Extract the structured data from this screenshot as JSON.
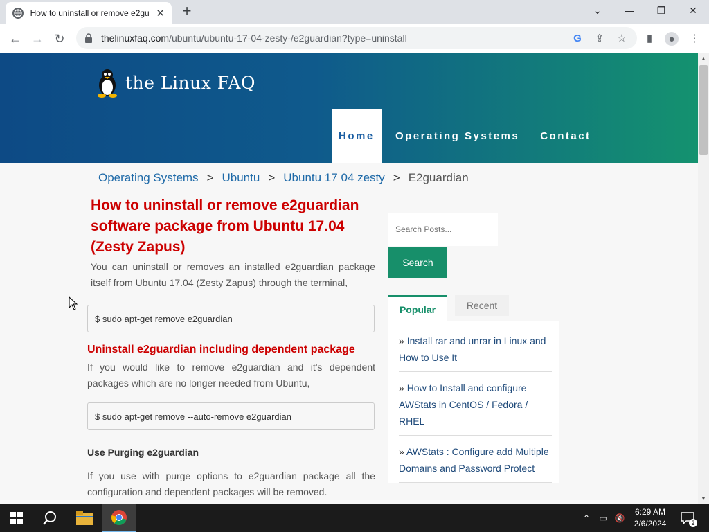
{
  "browser": {
    "tab_title": "How to uninstall or remove e2gu",
    "url_host": "thelinuxfaq.com",
    "url_path": "/ubuntu/ubuntu-17-04-zesty-/e2guardian?type=uninstall"
  },
  "site": {
    "logo_text": "the Linux FAQ",
    "nav": [
      "Home",
      "Operating Systems",
      "Contact"
    ]
  },
  "breadcrumb": {
    "items": [
      "Operating Systems",
      "Ubuntu",
      "Ubuntu 17 04 zesty"
    ],
    "separator": ">",
    "current": "E2guardian"
  },
  "article": {
    "title": "How to uninstall or remove e2guardian software package from Ubuntu 17.04 (Zesty Zapus)",
    "intro": "You can uninstall or removes an installed e2guardian package itself from Ubuntu 17.04 (Zesty Zapus) through the terminal,",
    "cmd1": "$ sudo apt-get remove e2guardian",
    "section2_title": "Uninstall e2guardian including dependent package",
    "section2_text": "If you would like to remove e2guardian and it's dependent packages which are no longer needed from Ubuntu,",
    "cmd2": "$ sudo apt-get remove --auto-remove e2guardian",
    "section3_title": "Use Purging e2guardian",
    "section3_text": "If you use with purge options to e2guardian package all the configuration and dependent packages will be removed."
  },
  "sidebar": {
    "search_placeholder": "Search Posts...",
    "search_button": "Search",
    "tab_popular": "Popular",
    "tab_recent": "Recent",
    "posts": [
      "Install rar and unrar in Linux and How to Use It",
      "How to Install and configure AWStats in CentOS / Fedora / RHEL",
      "AWStats : Configure add Multiple Domains and Password Protect"
    ],
    "bullet": "»"
  },
  "taskbar": {
    "time": "6:29 AM",
    "date": "2/6/2024",
    "notification_count": "2"
  },
  "colors": {
    "accent_green": "#178f6a",
    "title_red": "#cc0000",
    "link_blue": "#1f6aa8"
  }
}
